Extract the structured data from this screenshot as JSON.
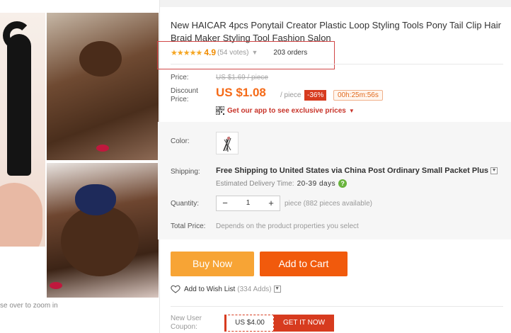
{
  "product": {
    "title": "New HAICAR 4pcs Ponytail Creator Plastic Loop Styling Tools Pony Tail Clip Hair Braid Maker Styling Tool Fashion Salon",
    "stars": "★★★★★",
    "rating": "4.9",
    "votes": "(54 votes)",
    "orders": "203 orders"
  },
  "gallery": {
    "zoom_hint": "se over to zoom in"
  },
  "price": {
    "price_label": "Price:",
    "old_price": "US $1.69 / piece",
    "discount_label": "Discount Price:",
    "discount_price": "US $1.08",
    "per_piece": "/ piece",
    "discount_badge": "-36%",
    "timer": "00h:25m:56s",
    "app_promo": "Get our app to see exclusive prices"
  },
  "options": {
    "color_label": "Color:",
    "shipping_label": "Shipping:",
    "shipping_free": "Free Shipping to",
    "shipping_dest": "United States via China Post Ordinary Small Packet Plus",
    "delivery_label": "Estimated Delivery Time:",
    "delivery_days": "20-39 days",
    "quantity_label": "Quantity:",
    "quantity_value": "1",
    "quantity_note": "piece (882 pieces available)",
    "total_label": "Total Price:",
    "total_note": "Depends on the product properties you select"
  },
  "actions": {
    "buy_now": "Buy Now",
    "add_to_cart": "Add to Cart",
    "wish_list": "Add to Wish List",
    "wish_adds": "(334 Adds)"
  },
  "coupon": {
    "label": "New User Coupon:",
    "value": "US $4.00",
    "get": "GET IT NOW"
  },
  "colors": {
    "accent_orange": "#f56a17",
    "buy_now_bg": "#f7a435",
    "add_to_cart_bg": "#f15a0c",
    "discount_red": "#d73b1f",
    "star_gold": "#f5a623"
  }
}
